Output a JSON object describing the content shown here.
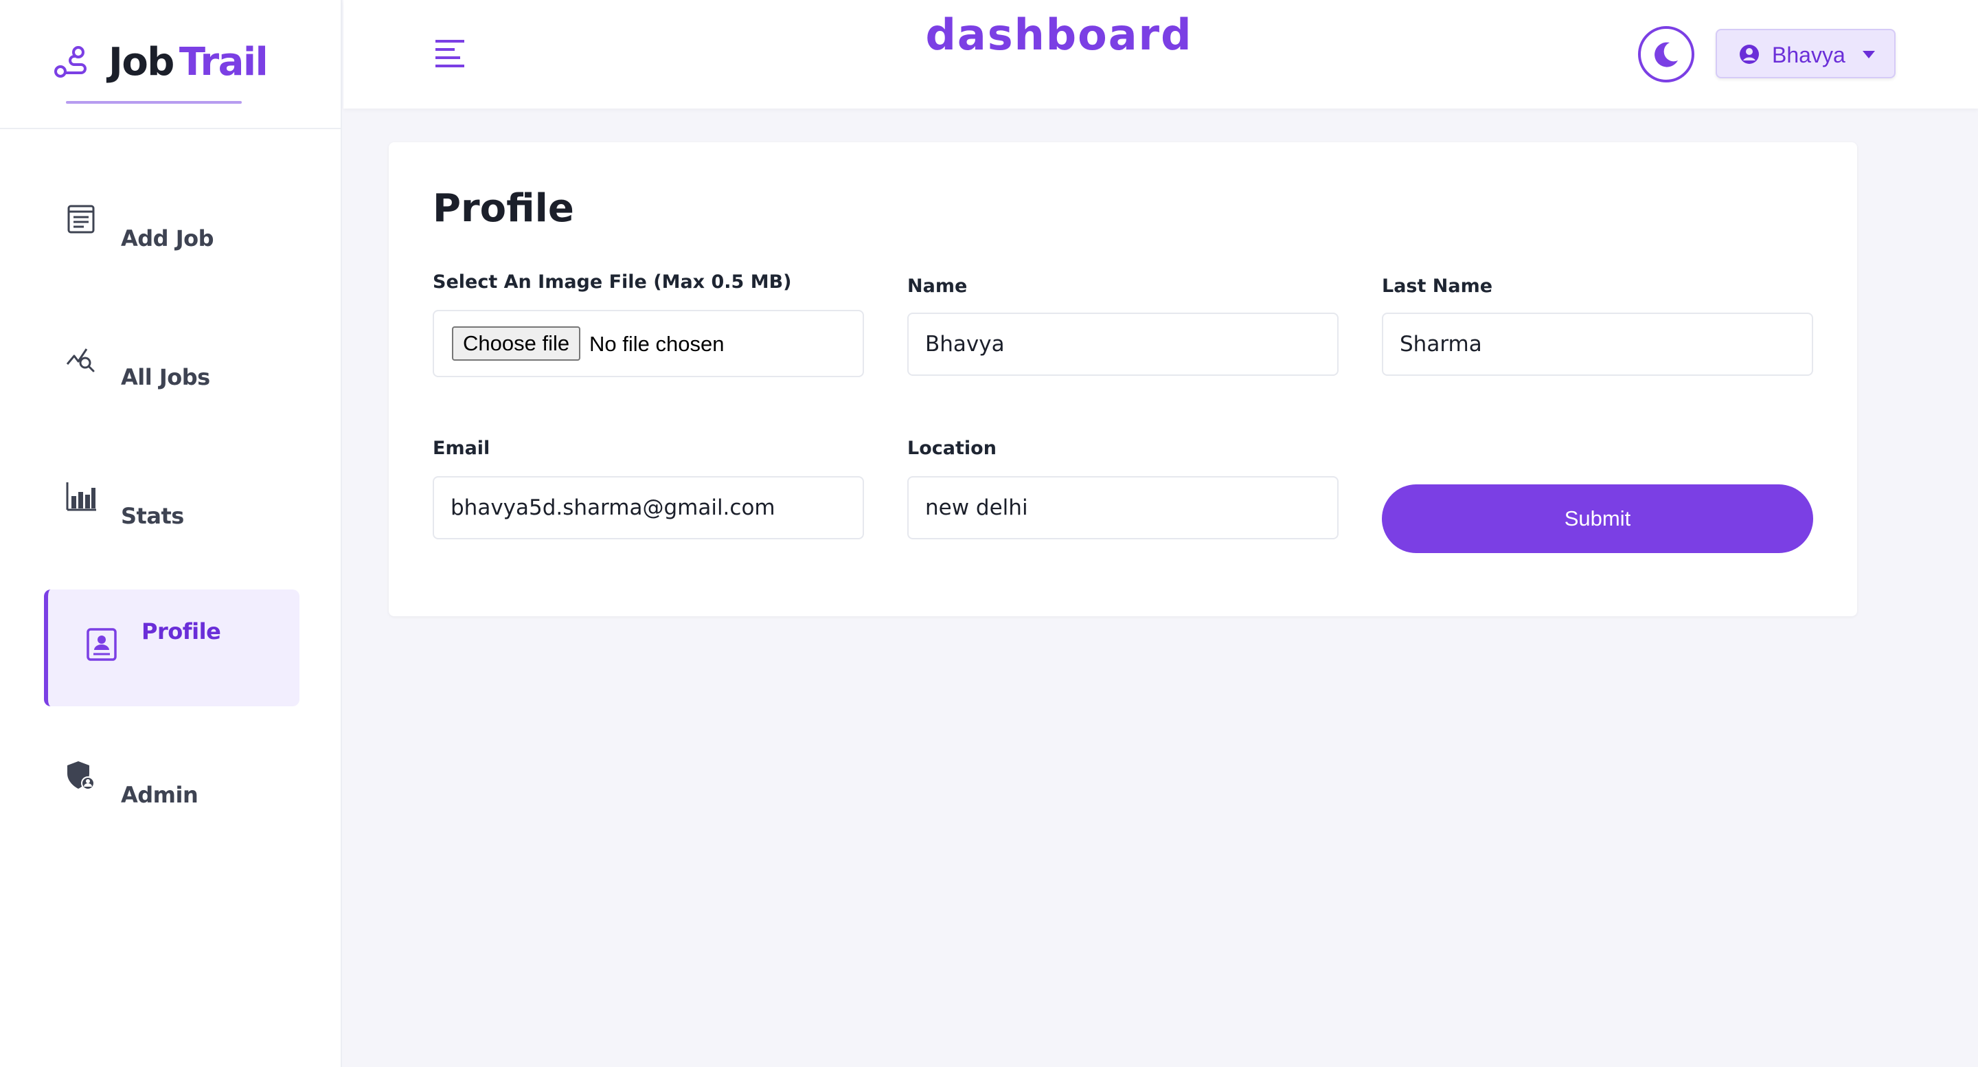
{
  "brand": {
    "name_part1": "Job",
    "name_part2": "Trail",
    "logo_icon": "route-icon"
  },
  "header": {
    "title": "dashboard",
    "menu_icon": "hamburger-menu-icon",
    "theme_icon": "moon-icon",
    "user": {
      "name": "Bhavya",
      "icon": "user-circle-icon",
      "caret_icon": "caret-down-icon"
    }
  },
  "sidebar": {
    "items": [
      {
        "label": "Add Job",
        "icon": "add-job-form-icon",
        "active": false
      },
      {
        "label": "All Jobs",
        "icon": "chart-search-icon",
        "active": false
      },
      {
        "label": "Stats",
        "icon": "bar-chart-icon",
        "active": false
      },
      {
        "label": "Profile",
        "icon": "profile-card-icon",
        "active": true
      },
      {
        "label": "Admin",
        "icon": "admin-shield-icon",
        "active": false
      }
    ]
  },
  "profile": {
    "title": "Profile",
    "image": {
      "label": "Select An Image File (Max 0.5 MB)",
      "button": "Choose file",
      "status": "No file chosen"
    },
    "name": {
      "label": "Name",
      "value": "Bhavya"
    },
    "last_name": {
      "label": "Last Name",
      "value": "Sharma"
    },
    "email": {
      "label": "Email",
      "value": "bhavya5d.sharma@gmail.com"
    },
    "location": {
      "label": "Location",
      "value": "new delhi"
    },
    "submit": "Submit"
  },
  "colors": {
    "accent": "#7b3fe4",
    "accent_light": "#f2eefe",
    "background": "#f5f5fa"
  }
}
